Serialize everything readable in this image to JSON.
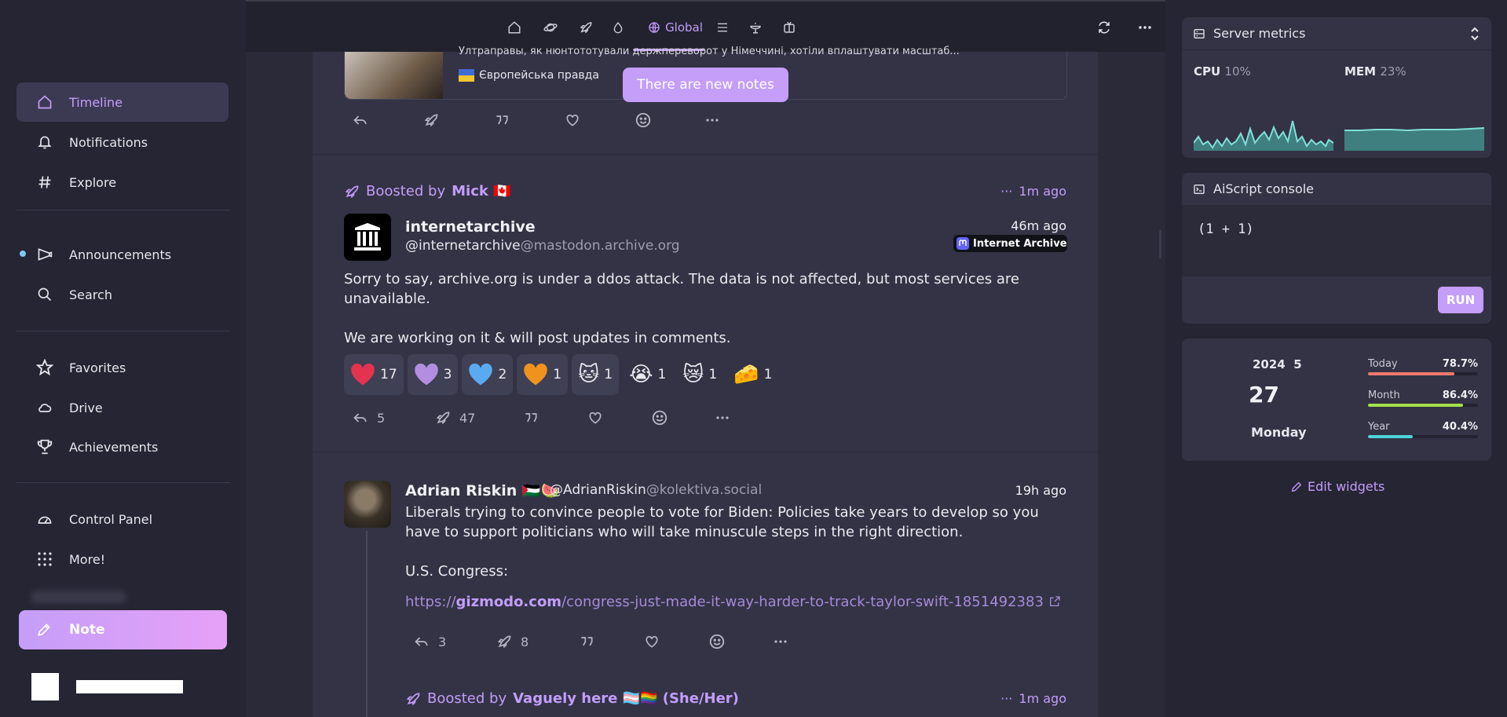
{
  "sidebar": {
    "items": [
      {
        "label": "Timeline",
        "icon": "home-icon"
      },
      {
        "label": "Notifications",
        "icon": "bell-icon"
      },
      {
        "label": "Explore",
        "icon": "hashtag-icon"
      },
      {
        "label": "Announcements",
        "icon": "megaphone-icon"
      },
      {
        "label": "Search",
        "icon": "search-icon"
      },
      {
        "label": "Favorites",
        "icon": "star-icon"
      },
      {
        "label": "Drive",
        "icon": "cloud-icon"
      },
      {
        "label": "Achievements",
        "icon": "trophy-icon"
      },
      {
        "label": "Control Panel",
        "icon": "gauge-icon"
      },
      {
        "label": "More!",
        "icon": "grid-dots-icon"
      }
    ],
    "note_button": "Note"
  },
  "topbar": {
    "active_tab": "Global"
  },
  "feed": {
    "top_card": {
      "description": "Ултраправы, як нюнтототували держпереворот у Німеччині, хотіли вплаштувати масштаб...",
      "source": "Європейська правда"
    },
    "new_notes": "There are new notes",
    "post1": {
      "boost_prefix": "Boosted by",
      "boosted_by": "Mick 🇨🇦",
      "boost_time": "1m ago",
      "name": "internetarchive",
      "handle_user": "@internetarchive",
      "handle_host": "@mastodon.archive.org",
      "time": "46m ago",
      "instance": "Internet Archive",
      "text1": "Sorry to say, archive.org is under a ddos attack. The data is not affected, but most services are unavailable.",
      "text2": "We are working on it & will post updates in comments.",
      "reactions": [
        {
          "emoji": "❤",
          "count": "17",
          "color": "#e3334f"
        },
        {
          "emoji": "❤",
          "count": "3",
          "color": "#b38ee0"
        },
        {
          "emoji": "❤",
          "count": "2",
          "color": "#5aaaf0"
        },
        {
          "emoji": "❤",
          "count": "1",
          "color": "#f0921e"
        },
        {
          "emoji": "🐱",
          "count": "1"
        },
        {
          "emoji": "😭",
          "count": "1"
        },
        {
          "emoji": "😿",
          "count": "1"
        },
        {
          "emoji": "🧀",
          "count": "1"
        }
      ],
      "replies": "5",
      "renotes": "47"
    },
    "post2": {
      "name": "Adrian Riskin 🇵🇸🍉",
      "handle_user": "@AdrianRiskin",
      "handle_host": "@kolektiva.social",
      "time": "19h ago",
      "text1": "Liberals trying to convince people to vote for Biden: Policies take years to develop so you have to support politicians who will take minuscule steps in the right direction.",
      "text2": "U.S. Congress:",
      "link_scheme": "https://",
      "link_host": "gizmodo.com",
      "link_path": "/congress-just-made-it-way-harder-to-track-taylor-swift-1851492383",
      "replies": "3",
      "renotes": "8"
    },
    "post3": {
      "boost_prefix": "Boosted by",
      "boosted_by": "Vaguely here 🏳️‍⚧️🏳️‍🌈 (She/Her)",
      "boost_time": "1m ago"
    }
  },
  "widgets": {
    "server_metrics": {
      "title": "Server metrics",
      "cpu_label": "CPU",
      "cpu_value": "10%",
      "mem_label": "MEM",
      "mem_value": "23%"
    },
    "aiscript": {
      "title": "AiScript console",
      "code": "(1 + 1)",
      "run": "RUN"
    },
    "calendar": {
      "year_month": "2024  5",
      "day": "27",
      "weekday": "Monday",
      "today_label": "Today",
      "today_value": "78.7%",
      "month_label": "Month",
      "month_value": "86.4%",
      "year_label": "Year",
      "year_value": "40.4%"
    },
    "edit": "Edit widgets"
  }
}
